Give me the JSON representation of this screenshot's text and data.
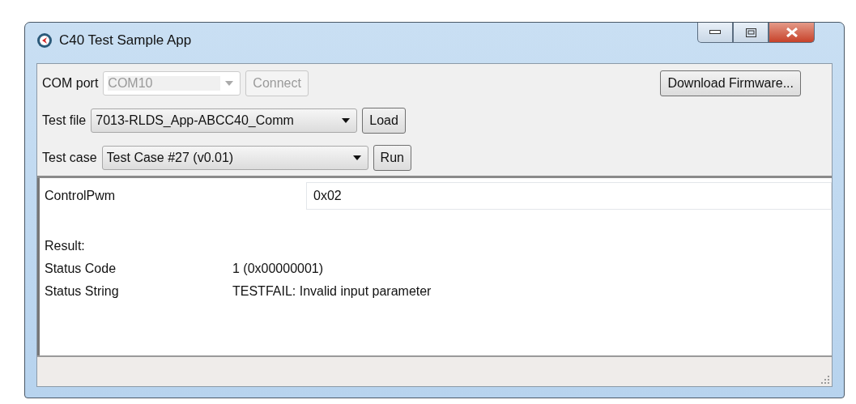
{
  "window": {
    "title": "C40 Test Sample App"
  },
  "com_port": {
    "label": "COM port",
    "value": "COM10",
    "disabled": true
  },
  "connect_button": {
    "label": "Connect",
    "disabled": true
  },
  "download_button": {
    "label": "Download Firmware...",
    "disabled": false
  },
  "test_file": {
    "label": "Test file",
    "value": "7013-RLDS_App-ABCC40_Comm",
    "disabled": false
  },
  "load_button": {
    "label": "Load",
    "disabled": false
  },
  "test_case": {
    "label": "Test case",
    "value": "Test Case #27 (v0.01)",
    "disabled": false
  },
  "run_button": {
    "label": "Run",
    "disabled": false
  },
  "parameters": [
    {
      "name": "ControlPwm",
      "value": "0x02"
    }
  ],
  "result": {
    "heading": "Result:",
    "rows": [
      {
        "name": "Status Code",
        "value": "1 (0x00000001)"
      },
      {
        "name": "Status String",
        "value": "TESTFAIL: Invalid input parameter"
      }
    ]
  }
}
